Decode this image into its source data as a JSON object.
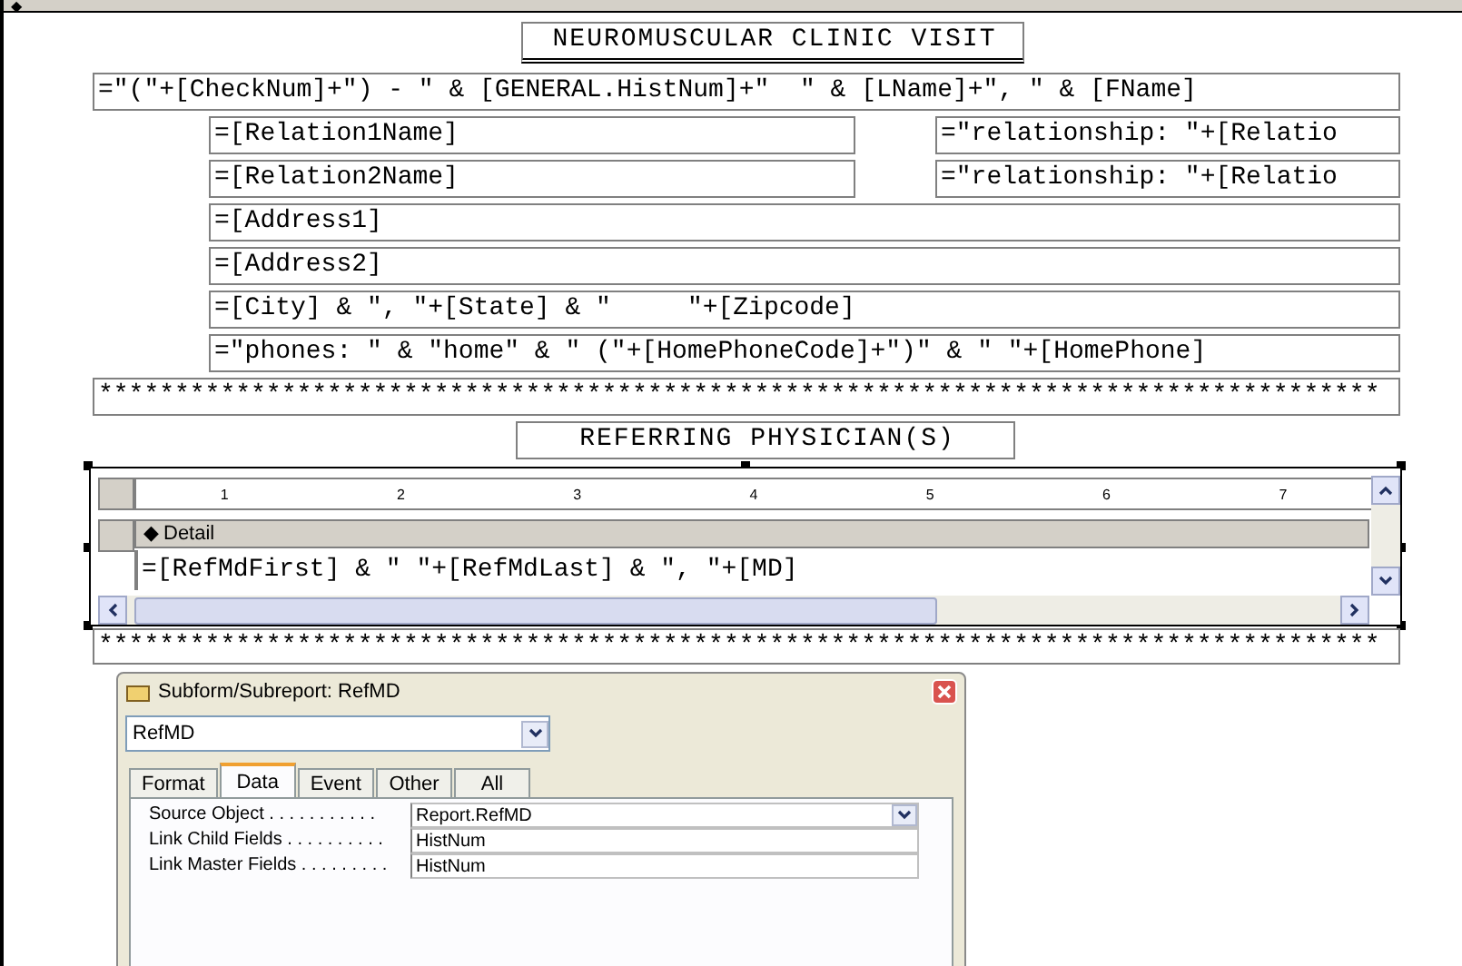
{
  "section_bar": {
    "icon": "◆"
  },
  "title": "NEUROMUSCULAR CLINIC VISIT",
  "fields": [
    {
      "text": "=\"(\"+[CheckNum]+\") - \" & [GENERAL.HistNum]+\"  \" & [LName]+\", \" & [FName]",
      "kind": "wide"
    },
    {
      "text": "=[Relation1Name]",
      "kind": "half"
    },
    {
      "text": "=\"relationship: \"+[Relatio",
      "kind": "side"
    },
    {
      "text": "=[Relation2Name]",
      "kind": "half"
    },
    {
      "text": "=\"relationship: \"+[Relatio",
      "kind": "side"
    },
    {
      "text": "=[Address1]",
      "kind": "indent"
    },
    {
      "text": "=[Address2]",
      "kind": "indent"
    },
    {
      "text": "=[City] & \", \"+[State] & \"     \"+[Zipcode]",
      "kind": "indent"
    },
    {
      "text": "=\"phones: \" & \"home\" & \" (\"+[HomePhoneCode]+\")\" & \" \"+[HomePhone]",
      "kind": "indent"
    },
    {
      "text": "************************************************************************************",
      "kind": "wide"
    }
  ],
  "subtitle": "REFERRING PHYSICIAN(S)",
  "subreport": {
    "ruler": [
      "1",
      "2",
      "3",
      "4",
      "5",
      "6",
      "7"
    ],
    "section": "Detail",
    "field": "=[RefMdFirst] & \" \"+[RefMdLast] & \", \"+[MD]"
  },
  "footer_stars": "************************************************************************************",
  "property_sheet": {
    "title": "Subform/Subreport: RefMD",
    "object": "RefMD",
    "tabs": [
      {
        "label": "Format",
        "selected": false
      },
      {
        "label": "Data",
        "selected": true
      },
      {
        "label": "Event",
        "selected": false
      },
      {
        "label": "Other",
        "selected": false
      },
      {
        "label": "All",
        "selected": false
      }
    ],
    "properties": [
      {
        "name": "Source Object . . . . . . . . . . .",
        "value": "Report.RefMD",
        "dropdown": true
      },
      {
        "name": "Link Child Fields . . . . . . . . . .",
        "value": "HistNum",
        "dropdown": false
      },
      {
        "name": "Link Master Fields . . . . . . . . .",
        "value": "HistNum",
        "dropdown": false
      }
    ]
  }
}
